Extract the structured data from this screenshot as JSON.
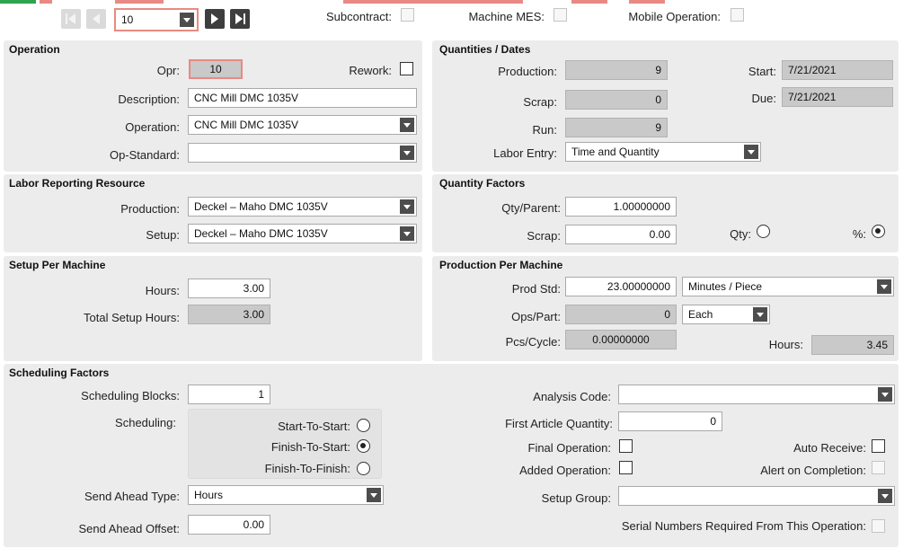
{
  "window": {
    "colors": {
      "accent": "#2ea44f",
      "highlight": "#e88a83",
      "panel": "#ececec",
      "readonly": "#c9c9c9"
    }
  },
  "nav": {
    "first_icon": "first-record-icon",
    "prev_icon": "previous-record-icon",
    "next_icon": "next-record-icon",
    "last_icon": "last-record-icon",
    "record_value": "10"
  },
  "header": {
    "subcontract_label": "Subcontract:",
    "machine_mes_label": "Machine MES:",
    "mobile_operation_label": "Mobile Operation:"
  },
  "operation": {
    "title": "Operation",
    "opr_label": "Opr:",
    "opr_value": "10",
    "rework_label": "Rework:",
    "description_label": "Description:",
    "description_value": "CNC Mill DMC 1035V",
    "operation_label": "Operation:",
    "operation_value": "CNC Mill DMC 1035V",
    "op_standard_label": "Op-Standard:",
    "op_standard_value": ""
  },
  "quantities": {
    "title": "Quantities / Dates",
    "production_label": "Production:",
    "production_value": "9",
    "scrap_label": "Scrap:",
    "scrap_value": "0",
    "run_label": "Run:",
    "run_value": "9",
    "labor_entry_label": "Labor Entry:",
    "labor_entry_value": "Time and Quantity",
    "start_label": "Start:",
    "start_value": "7/21/2021",
    "due_label": "Due:",
    "due_value": "7/21/2021"
  },
  "labor": {
    "title": "Labor Reporting Resource",
    "production_label": "Production:",
    "production_value": "Deckel – Maho DMC 1035V",
    "setup_label": "Setup:",
    "setup_value": "Deckel – Maho DMC 1035V"
  },
  "qty_factors": {
    "title": "Quantity Factors",
    "qty_parent_label": "Qty/Parent:",
    "qty_parent_value": "1.00000000",
    "scrap_label": "Scrap:",
    "scrap_value": "0.00",
    "qty_label": "Qty:",
    "pct_label": "%:"
  },
  "setup_machine": {
    "title": "Setup Per Machine",
    "hours_label": "Hours:",
    "hours_value": "3.00",
    "total_label": "Total Setup Hours:",
    "total_value": "3.00"
  },
  "prod_machine": {
    "title": "Production Per Machine",
    "prod_std_label": "Prod Std:",
    "prod_std_value": "23.00000000",
    "prod_std_unit": "Minutes / Piece",
    "ops_part_label": "Ops/Part:",
    "ops_part_value": "0",
    "ops_part_unit": "Each",
    "pcs_cycle_label": "Pcs/Cycle:",
    "pcs_cycle_value": "0.00000000",
    "hours_label": "Hours:",
    "hours_value": "3.45"
  },
  "scheduling": {
    "title": "Scheduling Factors",
    "blocks_label": "Scheduling Blocks:",
    "blocks_value": "1",
    "scheduling_label": "Scheduling:",
    "start_to_start": "Start-To-Start:",
    "finish_to_start": "Finish-To-Start:",
    "finish_to_finish": "Finish-To-Finish:",
    "send_ahead_type_label": "Send Ahead Type:",
    "send_ahead_type_value": "Hours",
    "send_ahead_offset_label": "Send Ahead Offset:",
    "send_ahead_offset_value": "0.00",
    "analysis_code_label": "Analysis Code:",
    "analysis_code_value": "",
    "first_article_label": "First Article Quantity:",
    "first_article_value": "0",
    "final_operation_label": "Final Operation:",
    "auto_receive_label": "Auto Receive:",
    "added_operation_label": "Added Operation:",
    "alert_label": "Alert on Completion:",
    "setup_group_label": "Setup Group:",
    "setup_group_value": "",
    "serial_label": "Serial Numbers Required From This Operation:"
  }
}
